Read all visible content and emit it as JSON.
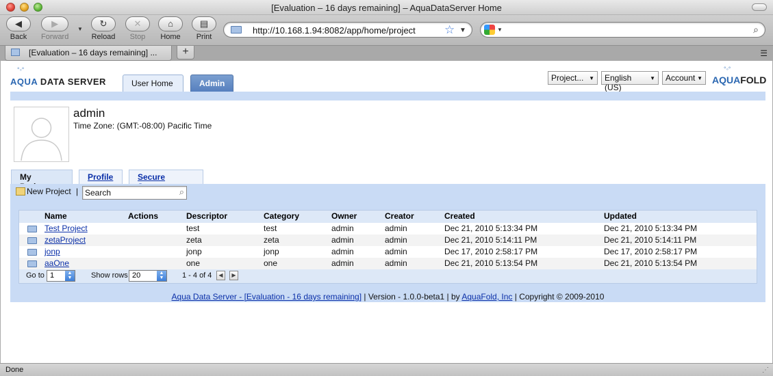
{
  "window": {
    "title": "[Evaluation – 16 days remaining] – AquaDataServer Home"
  },
  "toolbar": {
    "back": "Back",
    "forward": "Forward",
    "reload": "Reload",
    "stop": "Stop",
    "home": "Home",
    "print": "Print",
    "url": "http://10.168.1.94:8082/app/home/project",
    "search_value": ""
  },
  "browser_tab": {
    "label": "[Evaluation – 16 days remaining] ..."
  },
  "header": {
    "brand_left_aqua": "AQUA",
    "brand_left_rest": " DATA SERVER",
    "brand_right_aqua": "AQUA",
    "brand_right_rest": "FOLD",
    "tabs": [
      {
        "label": "User Home"
      },
      {
        "label": "Admin"
      }
    ],
    "selects": [
      {
        "label": "Project..."
      },
      {
        "label": "English (US)"
      },
      {
        "label": "Account"
      }
    ]
  },
  "user": {
    "name": "admin",
    "timezone": "Time Zone: (GMT:-08:00) Pacific Time"
  },
  "subtabs": [
    {
      "label": "My Projects"
    },
    {
      "label": "Profile"
    },
    {
      "label": "Secure Storage"
    }
  ],
  "projects_toolbar": {
    "new_project": "New Project",
    "separator": "|",
    "search_placeholder": "Search"
  },
  "table": {
    "columns": [
      "Name",
      "Actions",
      "Descriptor",
      "Category",
      "Owner",
      "Creator",
      "Created",
      "Updated"
    ],
    "rows": [
      {
        "name": "Test Project",
        "actions": "",
        "descriptor": "test",
        "category": "test",
        "owner": "admin",
        "creator": "admin",
        "created": "Dec 21, 2010 5:13:34 PM",
        "updated": "Dec 21, 2010 5:13:34 PM"
      },
      {
        "name": "zetaProject",
        "actions": "",
        "descriptor": "zeta",
        "category": "zeta",
        "owner": "admin",
        "creator": "admin",
        "created": "Dec 21, 2010 5:14:11 PM",
        "updated": "Dec 21, 2010 5:14:11 PM"
      },
      {
        "name": "jonp",
        "actions": "",
        "descriptor": "jonp",
        "category": "jonp",
        "owner": "admin",
        "creator": "admin",
        "created": "Dec 17, 2010 2:58:17 PM",
        "updated": "Dec 17, 2010 2:58:17 PM"
      },
      {
        "name": "aaOne",
        "actions": "",
        "descriptor": "one",
        "category": "one",
        "owner": "admin",
        "creator": "admin",
        "created": "Dec 21, 2010 5:13:54 PM",
        "updated": "Dec 21, 2010 5:13:54 PM"
      }
    ],
    "pager": {
      "goto_label": "Go to",
      "goto_value": "1",
      "rows_label": "Show rows",
      "rows_value": "20",
      "range": "1 - 4 of 4"
    }
  },
  "footer": {
    "product_link": "Aqua Data Server - [Evaluation - 16 days remaining]",
    "version": " | Version - 1.0.0-beta1 | by ",
    "company_link": "AquaFold, Inc",
    "copyright": " | Copyright © 2009-2010"
  },
  "status": {
    "text": "Done"
  }
}
